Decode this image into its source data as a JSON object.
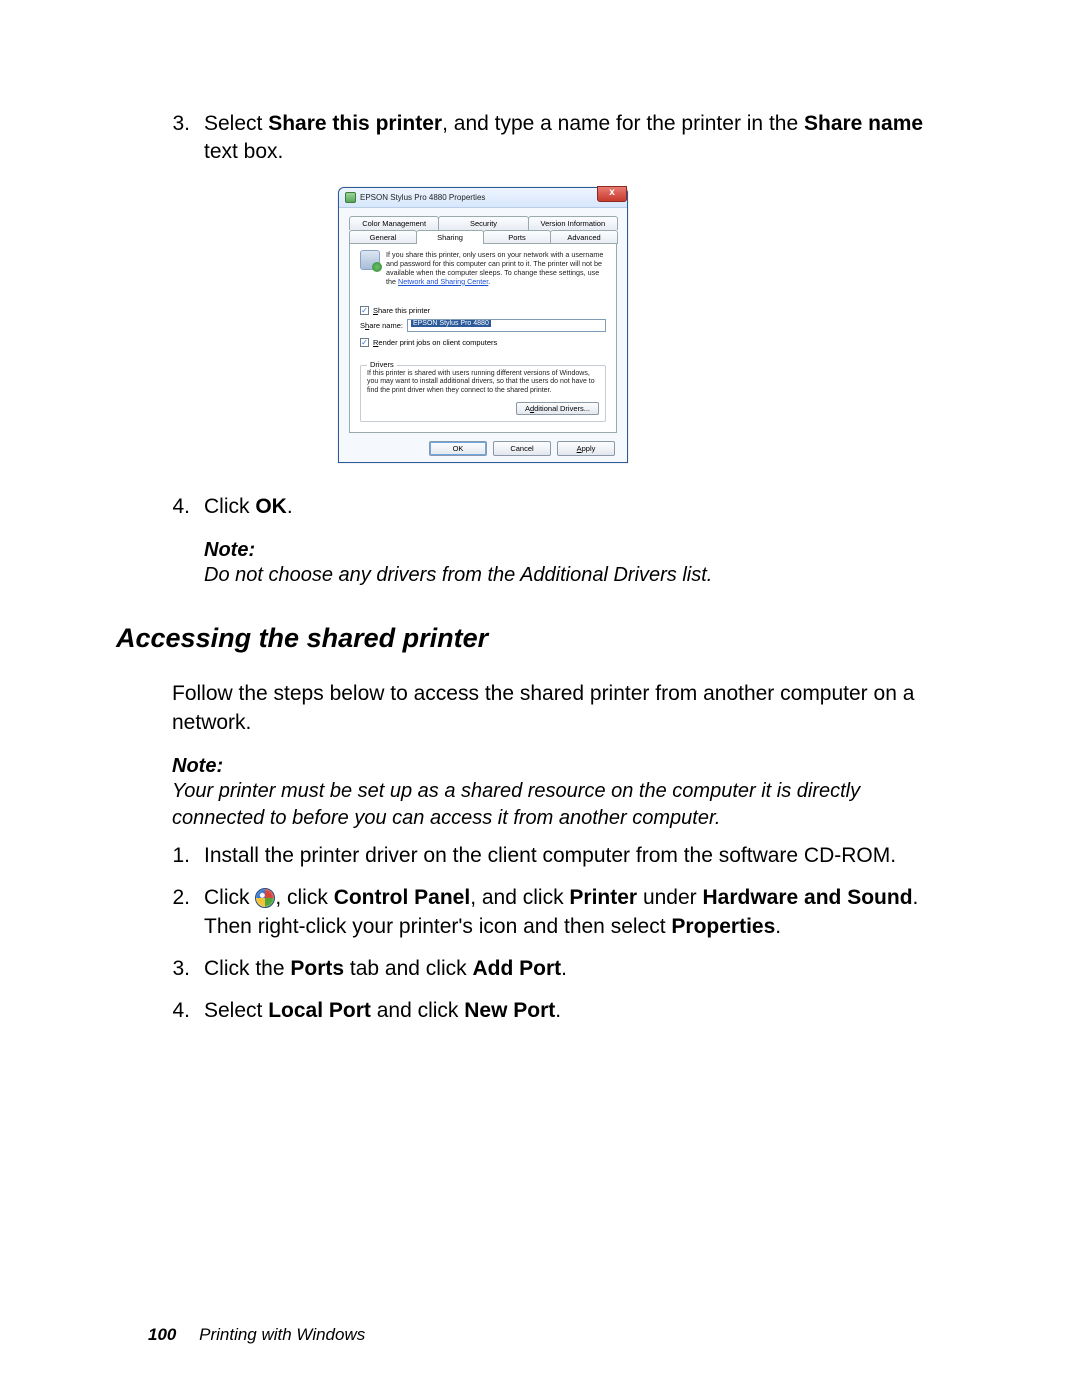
{
  "steps_a": {
    "s3": {
      "num": "3.",
      "pre": "Select ",
      "b1": "Share this printer",
      "mid": ", and type a name for the printer in the ",
      "b2": "Share name",
      "post": " text box."
    },
    "s4": {
      "num": "4.",
      "pre": "Click ",
      "b1": "OK",
      "post": "."
    }
  },
  "note1": {
    "label": "Note:",
    "body": "Do not choose any drivers from the Additional Drivers list."
  },
  "section_heading": "Accessing the shared printer",
  "intro": "Follow the steps below to access the shared printer from another computer on a network.",
  "note2": {
    "label": "Note:",
    "body": "Your printer must be set up as a shared resource on the computer it is directly connected to before you can access it from another computer."
  },
  "steps_b": {
    "s1": {
      "num": "1.",
      "text": "Install the printer driver on the client computer from the software CD-ROM."
    },
    "s2": {
      "num": "2.",
      "pre": "Click ",
      "mid1": ", click ",
      "b1": "Control Panel",
      "mid2": ", and click ",
      "b2": "Printer",
      "mid3": " under ",
      "b3": "Hardware and Sound",
      "mid4": ". Then right-click your printer's icon and then select ",
      "b4": "Properties",
      "post": "."
    },
    "s3": {
      "num": "3.",
      "pre": "Click the ",
      "b1": "Ports",
      "mid": " tab and click ",
      "b2": "Add Port",
      "post": "."
    },
    "s4": {
      "num": "4.",
      "pre": "Select ",
      "b1": "Local Port",
      "mid": " and click ",
      "b2": "New Port",
      "post": "."
    }
  },
  "footer": {
    "page": "100",
    "chapter": "Printing with Windows"
  },
  "dialog": {
    "title": "EPSON Stylus Pro 4880 Properties",
    "close": "x",
    "tabs_top": [
      "Color Management",
      "Security",
      "Version Information"
    ],
    "tabs_bottom": [
      "General",
      "Sharing",
      "Ports",
      "Advanced"
    ],
    "active_tab": "Sharing",
    "share_info": "If you share this printer, only users on your network with a username and password for this computer can print to it. The printer will not be available when the computer sleeps. To change these settings, use the ",
    "share_info_link": "Network and Sharing Center",
    "share_info_post": ".",
    "share_checkbox": "Share this printer",
    "share_name_label": "Share name:",
    "share_name_value": "EPSON Stylus Pro 4880",
    "render_checkbox": "Render print jobs on client computers",
    "drivers_group": "Drivers",
    "drivers_text": "If this printer is shared with users running different versions of Windows, you may want to install additional drivers, so that the users do not have to find the print driver when they connect to the shared printer.",
    "additional_drivers": "Additional Drivers...",
    "ok": "OK",
    "cancel": "Cancel",
    "apply": "Apply",
    "check_mark": "✓"
  }
}
